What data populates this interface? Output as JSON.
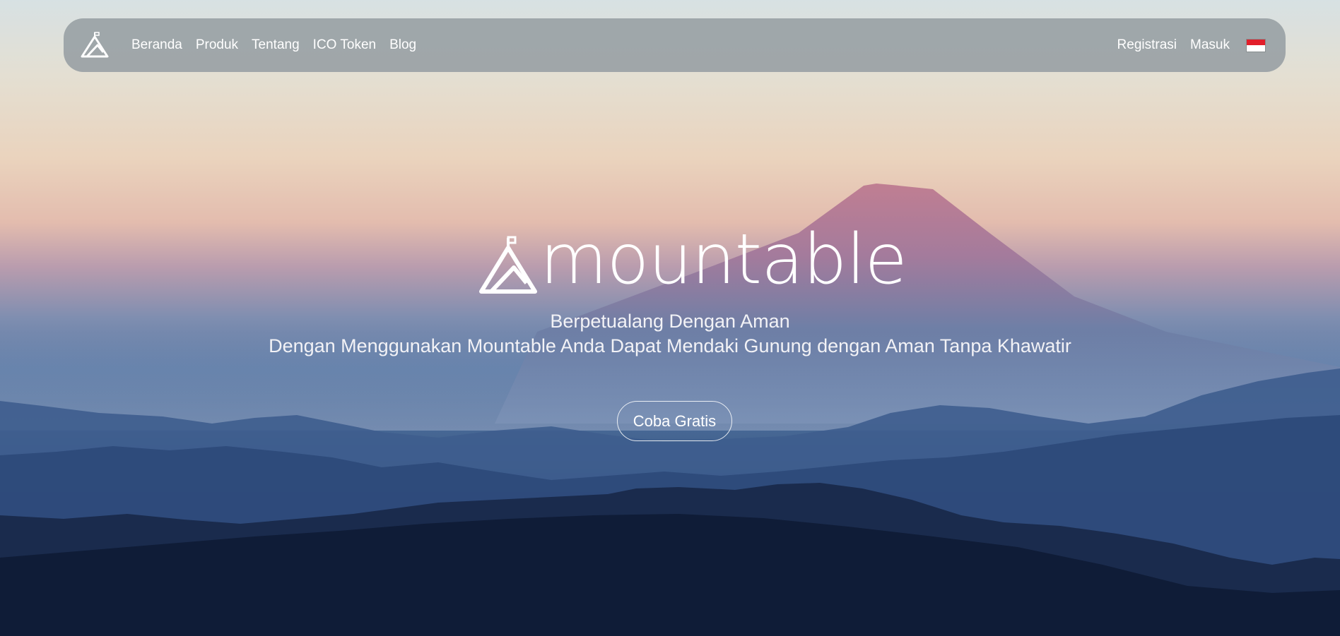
{
  "colors": {
    "navbar_bg": "#969ea3",
    "text": "#ffffff",
    "flag_red": "#e21e2a",
    "flag_white": "#ffffff"
  },
  "nav": {
    "logo_icon": "mountain-tent-logo-icon",
    "left_links": [
      "Beranda",
      "Produk",
      "Tentang",
      "ICO Token",
      "Blog"
    ],
    "register_label": "Registrasi",
    "login_label": "Masuk",
    "language_icon": "indonesia-flag-icon"
  },
  "hero": {
    "brand_name": "mountable",
    "tagline_line1": "Berpetualang Dengan Aman",
    "tagline_line2": "Dengan Menggunakan Mountable Anda Dapat Mendaki Gunung dengan Aman Tanpa Khawatir",
    "cta_label": "Coba Gratis",
    "background": "mountain-landscape-image"
  }
}
